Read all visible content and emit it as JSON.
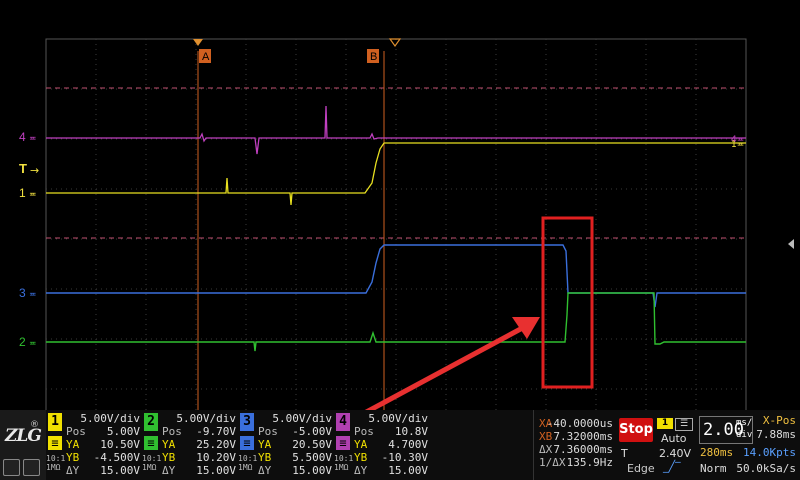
{
  "markers": {
    "a": "A",
    "b": "B"
  },
  "channel_labels": [
    {
      "text": "4",
      "color": "#c040c0"
    },
    {
      "text": "T",
      "color": "#f0e040"
    },
    {
      "text": "1",
      "color": "#f0e040"
    },
    {
      "text": "3",
      "color": "#3a6fdc"
    },
    {
      "text": "2",
      "color": "#30c030"
    }
  ],
  "channels": [
    {
      "num": "1",
      "color": "#f0e000",
      "scale": "5.00V/div",
      "pos": "5.00V",
      "ya": "10.50V",
      "yb": "-4.500V",
      "dy": "15.00V",
      "coupling": "10:1",
      "impedance": "1MΩ"
    },
    {
      "num": "2",
      "color": "#30c030",
      "scale": "5.00V/div",
      "pos": "-9.70V",
      "ya": "25.20V",
      "yb": "10.20V",
      "dy": "15.00V",
      "coupling": "10:1",
      "impedance": "1MΩ"
    },
    {
      "num": "3",
      "color": "#3a6fdc",
      "scale": "5.00V/div",
      "pos": "-5.00V",
      "ya": "20.50V",
      "yb": "5.500V",
      "dy": "15.00V",
      "coupling": "10:1",
      "impedance": "1MΩ"
    },
    {
      "num": "4",
      "color": "#b040b0",
      "scale": "5.00V/div",
      "pos": "10.8V",
      "ya": "4.700V",
      "yb": "-10.30V",
      "dy": "15.00V",
      "coupling": "10:1",
      "impedance": "1MΩ"
    }
  ],
  "row_labels": {
    "pos": "Pos",
    "ya": "YA",
    "yb": "YB",
    "dy": "ΔY"
  },
  "measure": {
    "xa_label": "XA",
    "xa": "-40.0000us",
    "xb_label": "XB",
    "xb": "7.32000ms",
    "dx_label": "ΔX",
    "dx": "7.36000ms",
    "inv_label": "1/ΔX",
    "inv": "135.9Hz"
  },
  "trigger": {
    "state": "Stop",
    "source": "1",
    "mode": "Auto",
    "level_label": "T",
    "level": "2.40V",
    "type": "Edge"
  },
  "timebase": {
    "value": "2.00",
    "unit_top": "ms/",
    "unit_bottom": "div",
    "xpos_label": "X-Pos",
    "xpos": "7.88ms",
    "memory": "280ms",
    "points": "14.0Kpts",
    "acq_mode": "Norm",
    "sample_rate": "50.0kSa/s"
  },
  "colors": {
    "grid": "#3a3a3a",
    "cursor": "#d06020",
    "ch1": "#f0e000",
    "ch2": "#30c030",
    "ch3": "#3a6fdc",
    "ch4": "#c040c0",
    "highlight": "#e02020"
  }
}
